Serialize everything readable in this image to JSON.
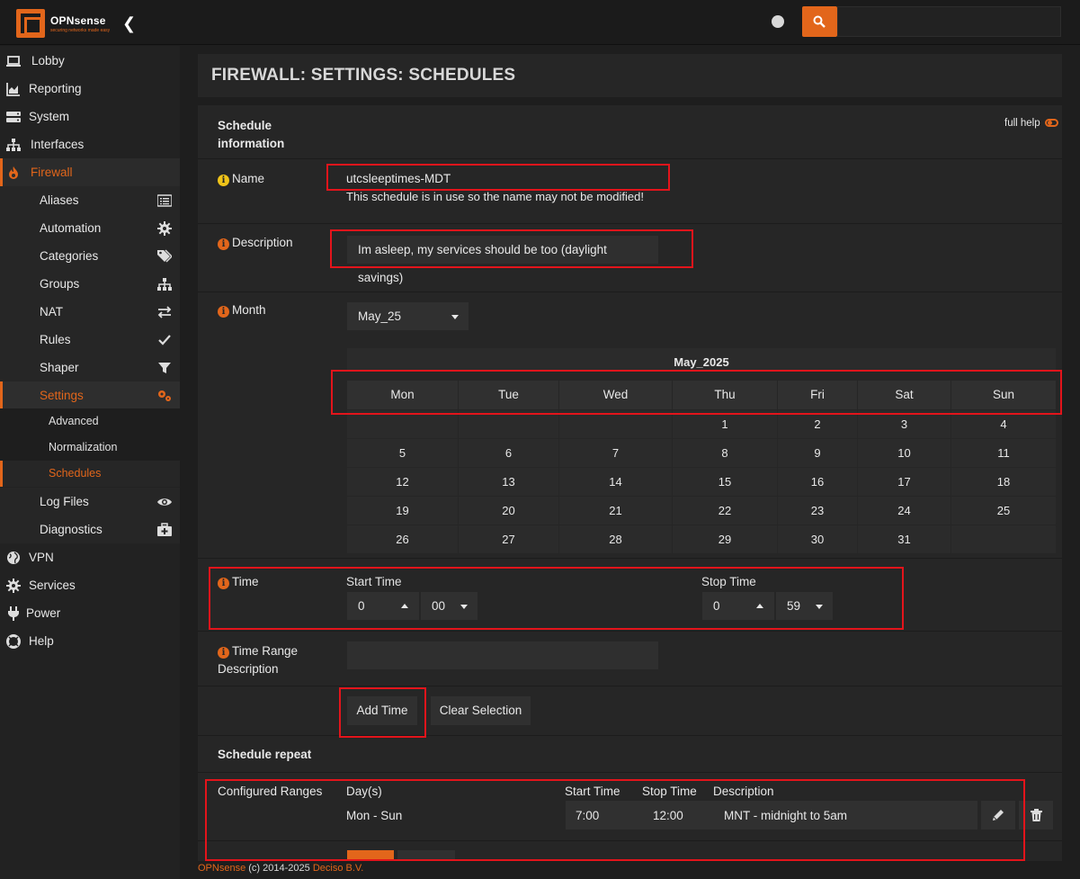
{
  "app": {
    "logo_text": "OPNsense",
    "logo_sub": "securing networks made easy",
    "search_placeholder": ""
  },
  "sidebar": {
    "items": [
      {
        "label": "Lobby",
        "icon": "laptop-icon"
      },
      {
        "label": "Reporting",
        "icon": "area-chart-icon"
      },
      {
        "label": "System",
        "icon": "server-icon"
      },
      {
        "label": "Interfaces",
        "icon": "sitemap-icon"
      },
      {
        "label": "Firewall",
        "icon": "fire-icon"
      },
      {
        "label": "VPN",
        "icon": "globe-icon"
      },
      {
        "label": "Services",
        "icon": "gear-icon"
      },
      {
        "label": "Power",
        "icon": "plug-icon"
      },
      {
        "label": "Help",
        "icon": "life-ring-icon"
      }
    ],
    "firewall_sub": [
      {
        "label": "Aliases",
        "icon": "list-icon"
      },
      {
        "label": "Automation",
        "icon": "gear-icon"
      },
      {
        "label": "Categories",
        "icon": "tags-icon"
      },
      {
        "label": "Groups",
        "icon": "sitemap-icon"
      },
      {
        "label": "NAT",
        "icon": "exchange-icon"
      },
      {
        "label": "Rules",
        "icon": "check-icon"
      },
      {
        "label": "Shaper",
        "icon": "filter-icon"
      },
      {
        "label": "Settings",
        "icon": "gears-icon"
      }
    ],
    "settings_sub": [
      "Advanced",
      "Normalization",
      "Schedules"
    ],
    "after_settings": [
      {
        "label": "Log Files",
        "icon": "eye-icon"
      },
      {
        "label": "Diagnostics",
        "icon": "medkit-icon"
      }
    ]
  },
  "page": {
    "title": "FIREWALL: SETTINGS: SCHEDULES"
  },
  "form": {
    "section_title_1": "Schedule",
    "section_title_2": "information",
    "full_help": "full help",
    "name_label": "Name",
    "name_value": "utcsleeptimes-MDT",
    "name_note": "This schedule is in use so the name may not be modified!",
    "description_label": "Description",
    "description_value": "Im asleep, my services should be too (daylight savings)",
    "month_label": "Month",
    "month_value": "May_25",
    "time_label": "Time",
    "start_time_label": "Start Time",
    "stop_time_label": "Stop Time",
    "start_hour": "0",
    "start_min": "00",
    "stop_hour": "0",
    "stop_min": "59",
    "time_range_label_1": "Time Range",
    "time_range_label_2": "Description",
    "time_range_value": "",
    "add_time_button": "Add Time",
    "clear_selection_button": "Clear Selection",
    "schedule_repeat_title": "Schedule repeat",
    "configured_ranges_label": "Configured Ranges"
  },
  "calendar": {
    "title": "May_2025",
    "days": [
      "Mon",
      "Tue",
      "Wed",
      "Thu",
      "Fri",
      "Sat",
      "Sun"
    ],
    "weeks": [
      [
        "",
        "",
        "",
        "1",
        "2",
        "3",
        "4"
      ],
      [
        "5",
        "6",
        "7",
        "8",
        "9",
        "10",
        "11"
      ],
      [
        "12",
        "13",
        "14",
        "15",
        "16",
        "17",
        "18"
      ],
      [
        "19",
        "20",
        "21",
        "22",
        "23",
        "24",
        "25"
      ],
      [
        "26",
        "27",
        "28",
        "29",
        "30",
        "31",
        ""
      ]
    ]
  },
  "ranges": {
    "headers": [
      "Day(s)",
      "Start Time",
      "Stop Time",
      "Description"
    ],
    "rows": [
      {
        "days": "Mon - Sun",
        "start": "7:00",
        "stop": "12:00",
        "description": "MNT - midnight to 5am"
      }
    ]
  },
  "footer": {
    "brand": "OPNsense",
    "copy": "(c) 2014-2025",
    "company": "Deciso B.V."
  },
  "colors": {
    "accent": "#e2661b",
    "highlight_box": "#e3141b",
    "info_yellow": "#f0c419"
  }
}
